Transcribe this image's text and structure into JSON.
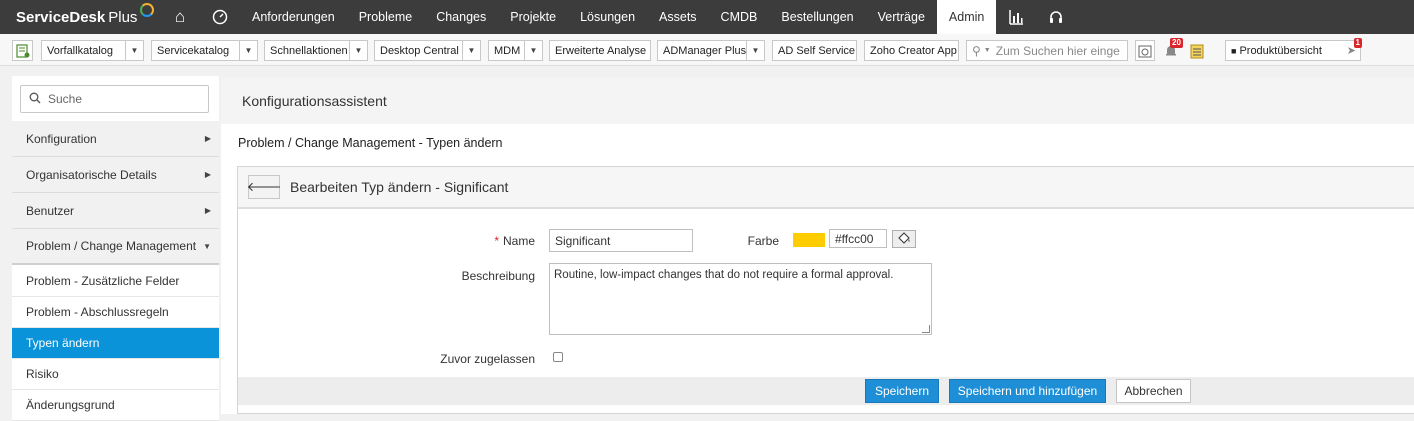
{
  "topnav": {
    "brand": "ServiceDesk",
    "brand_suffix": "Plus",
    "items": [
      "Anforderungen",
      "Probleme",
      "Changes",
      "Projekte",
      "Lösungen",
      "Assets",
      "CMDB",
      "Bestellungen",
      "Verträge",
      "Admin"
    ],
    "active": "Admin"
  },
  "toolbar": {
    "vorfall": "Vorfallkatalog",
    "service": "Servicekatalog",
    "schnell": "Schnellaktionen",
    "desktop": "Desktop Central",
    "mdm": "MDM",
    "erweitert": "Erweiterte Analyse",
    "admanager": "ADManager Plus",
    "adself": "AD Self Service",
    "zoho": "Zoho Creator App",
    "search_placeholder": "Zum Suchen hier einge",
    "notifications_count": "20",
    "produkt": "Produktübersicht",
    "rocket_count": "1"
  },
  "sidebar": {
    "search_placeholder": "Suche",
    "groups": [
      "Konfiguration",
      "Organisatorische Details",
      "Benutzer",
      "Problem / Change Management"
    ],
    "subitems": [
      "Problem - Zusätzliche Felder",
      "Problem - Abschlussregeln",
      "Typen ändern",
      "Risiko",
      "Änderungsgrund"
    ],
    "active_subitem": "Typen ändern"
  },
  "main": {
    "header": "Konfigurationsassistent",
    "breadcrumb": "Problem / Change Management - Typen ändern",
    "card_title": "Bearbeiten Typ ändern - Significant"
  },
  "form": {
    "name_label": "Name",
    "name_required_mark": "*",
    "name_value": "Significant",
    "color_label": "Farbe",
    "color_value": "#ffcc00",
    "color_hex": "#ffcc00",
    "description_label": "Beschreibung",
    "description_value": "Routine, low-impact changes that do not require a formal approval.",
    "preapproved_label": "Zuvor zugelassen",
    "preapproved_checked": false
  },
  "buttons": {
    "save": "Speichern",
    "save_add": "Speichern und hinzufügen",
    "cancel": "Abbrechen"
  }
}
